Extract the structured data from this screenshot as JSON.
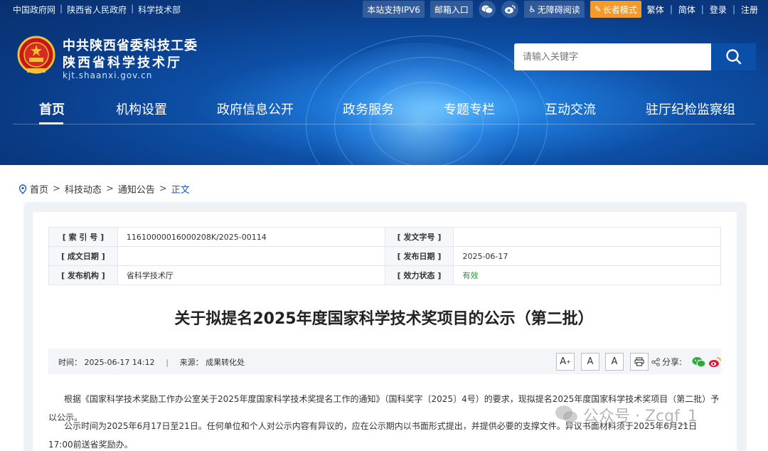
{
  "topbar": {
    "links": [
      "中国政府网",
      "陕西省人民政府",
      "科学技术部"
    ],
    "ipv6": "本站支持IPV6",
    "mail": "邮箱入口",
    "wechat_icon": "wechat-icon",
    "weibo_icon": "weibo-icon",
    "accessible": "无障碍阅读",
    "elder": "长者模式",
    "traditional": "繁体",
    "simplified": "简体",
    "login": "登录",
    "register": "注册"
  },
  "site": {
    "name_line1": "中共陕西省委科技工委",
    "name_line2": "陕西省科学技术厅",
    "url": "kjt.shaanxi.gov.cn"
  },
  "search": {
    "placeholder": "请输入关键字"
  },
  "nav": {
    "items": [
      "首页",
      "机构设置",
      "政府信息公开",
      "政务服务",
      "专题专栏",
      "互动交流",
      "驻厅纪检监察组"
    ],
    "active_index": 0
  },
  "breadcrumb": [
    "首页",
    "科技动态",
    "通知公告",
    "正文"
  ],
  "meta": {
    "index_no_label": "[ 索 引 号 ]",
    "index_no": "11610000016000208K/2025-00114",
    "doc_no_label": "[ 发文字号 ]",
    "doc_no": "",
    "created_label": "[ 成文日期 ]",
    "created": "",
    "published_label": "[ 发布日期 ]",
    "published": "2025-06-17",
    "issuer_label": "[ 发布机构 ]",
    "issuer": "省科学技术厅",
    "status_label": "[ 效力状态 ]",
    "status": "有效"
  },
  "article": {
    "title": "关于拟提名2025年度国家科学技术奖项目的公示（第二批）",
    "time_label": "时间：",
    "time": "2025-06-17 14:12",
    "source_label": "来源：",
    "source": "成果转化处",
    "font_large": "A",
    "font_medium": "A",
    "font_small": "A",
    "share_label": "分享:",
    "para1": "根据《国家科学技术奖励工作办公室关于2025年度国家科学技术奖提名工作的通知》（国科奖字〔2025〕4号）的要求，现拟提名2025年度国家科学技术奖项目（第二批）予以公示。",
    "para2": "公示时间为2025年6月17日至21日。任何单位和个人对公示内容有异议的，应在公示期内以书面形式提出，并提供必要的支撑文件。异议书面材料须于2025年6月21日17:00前送省奖励办。"
  },
  "watermark": {
    "text": "公众号 · Zcgf_1"
  },
  "colors": {
    "accent": "#0a4fa8",
    "elder": "#f39a28",
    "status_green": "#1a9b2c"
  }
}
